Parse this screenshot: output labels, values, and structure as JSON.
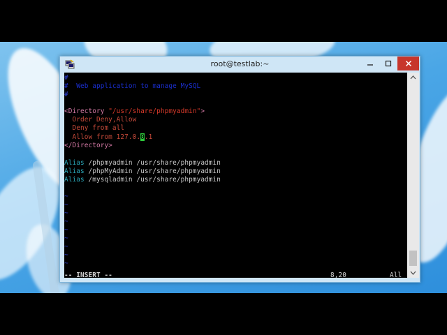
{
  "window": {
    "title": "root@testlab:~",
    "close_color": "#c7362b",
    "frame_color": "#cfe6f6"
  },
  "icons": {
    "app": "putty-icon",
    "minimize": "minimize-icon",
    "maximize": "maximize-icon",
    "close": "close-icon"
  },
  "terminal": {
    "comment_text": "#  Web application to manage MySQL",
    "directory_open_tag": "<Directory ",
    "directory_path": "\"/usr/share/phpmyadmin\"",
    "directory_open_end": ">",
    "order_directive": "  Order Deny,Allow",
    "deny_directive": "  Deny from all",
    "allow_prefix": "  Allow from 127.0.",
    "allow_cursor_char": "0",
    "allow_suffix": ".1",
    "directory_close_tag": "</Directory>",
    "aliases": [
      {
        "keyword": "Alias",
        "args": " /phpmyadmin /usr/share/phpmyadmin"
      },
      {
        "keyword": "Alias",
        "args": " /phpMyAdmin /usr/share/phpmyadmin"
      },
      {
        "keyword": "Alias",
        "args": " /mysqladmin /usr/share/phpmyadmin"
      }
    ],
    "tilde": "~",
    "mode": "-- INSERT --",
    "position": "8,20",
    "scroll": "All",
    "colors": {
      "comment": "#1a2fd0",
      "cursor": "#2ec83b",
      "keyword": "#c84a3a",
      "alias": "#2aa7b8"
    }
  }
}
